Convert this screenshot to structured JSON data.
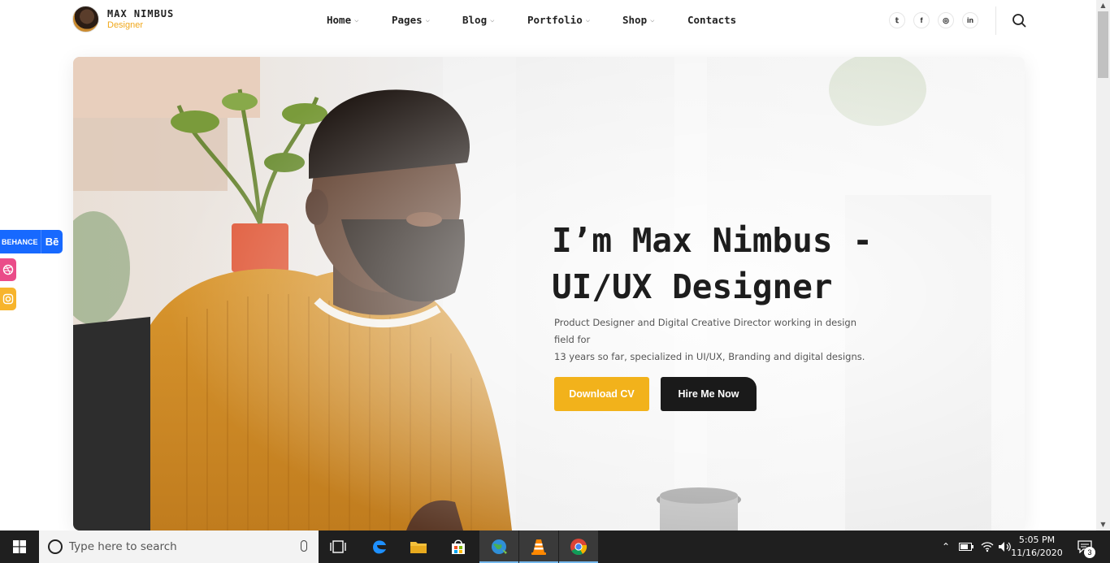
{
  "site": {
    "name": "MAX NIMBUS",
    "role": "Designer"
  },
  "nav": {
    "items": [
      {
        "label": "Home",
        "active": true,
        "has_dropdown": true
      },
      {
        "label": "Pages",
        "has_dropdown": true
      },
      {
        "label": "Blog",
        "has_dropdown": true
      },
      {
        "label": "Portfolio",
        "has_dropdown": true
      },
      {
        "label": "Shop",
        "has_dropdown": true
      },
      {
        "label": "Contacts",
        "has_dropdown": false
      }
    ]
  },
  "header_socials": [
    {
      "icon": "twitter-icon",
      "glyph": "𝕥"
    },
    {
      "icon": "facebook-icon",
      "glyph": "f"
    },
    {
      "icon": "instagram-icon",
      "glyph": "◎"
    },
    {
      "icon": "linkedin-icon",
      "glyph": "in"
    }
  ],
  "hero": {
    "title_line1": "I’m Max Nimbus -",
    "title_line2": "UI/UX Designer",
    "description_line1": "Product Designer and Digital Creative Director working in design field for",
    "description_line2": "13 years so far, specialized in UI/UX, Branding and digital designs.",
    "cta_primary": "Download CV",
    "cta_secondary": "Hire Me Now"
  },
  "floating_social": {
    "behance_label": "BEHANCE",
    "behance_glyph": "Bē"
  },
  "taskbar": {
    "search_placeholder": "Type here to search",
    "time": "5:05 PM",
    "date": "11/16/2020",
    "notification_count": "3"
  },
  "colors": {
    "accent": "#f2b21b",
    "dark": "#1a1a1a",
    "behance": "#1769ff",
    "dribbble": "#ea4c89",
    "instagram": "#f7b42c",
    "taskbar": "#1f1f1f"
  }
}
